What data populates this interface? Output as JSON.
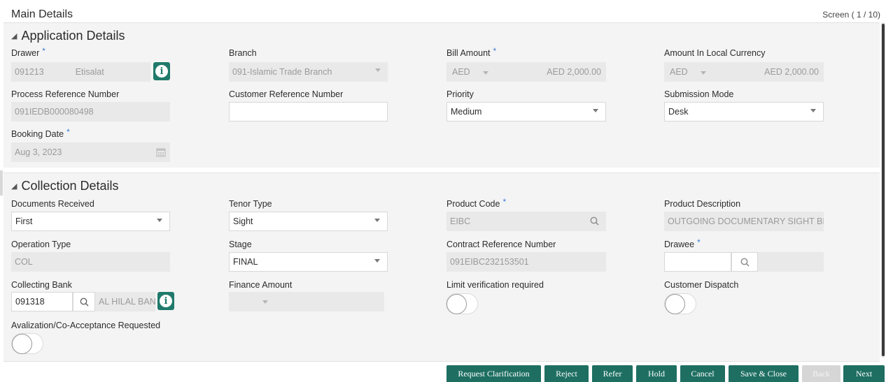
{
  "header": {
    "title": "Main Details",
    "screen": "Screen ( 1 / 10)"
  },
  "application_details": {
    "title": "Application Details",
    "drawer": {
      "label": "Drawer",
      "id": "091213",
      "name": "Etisalat"
    },
    "branch": {
      "label": "Branch",
      "value": "091-Islamic Trade Branch"
    },
    "bill_amount": {
      "label": "Bill Amount",
      "currency": "AED",
      "amount": "AED 2,000.00"
    },
    "amount_local": {
      "label": "Amount In Local Currency",
      "currency": "AED",
      "amount": "AED 2,000.00"
    },
    "process_ref": {
      "label": "Process Reference Number",
      "value": "091IEDB000080498"
    },
    "customer_ref": {
      "label": "Customer Reference Number",
      "value": ""
    },
    "priority": {
      "label": "Priority",
      "value": "Medium"
    },
    "submission_mode": {
      "label": "Submission Mode",
      "value": "Desk"
    },
    "booking_date": {
      "label": "Booking Date",
      "value": "Aug 3, 2023"
    }
  },
  "collection_details": {
    "title": "Collection Details",
    "documents_received": {
      "label": "Documents Received",
      "value": "First"
    },
    "tenor_type": {
      "label": "Tenor Type",
      "value": "Sight"
    },
    "product_code": {
      "label": "Product Code",
      "value": "EIBC"
    },
    "product_description": {
      "label": "Product Description",
      "value": "OUTGOING DOCUMENTARY SIGHT BILL"
    },
    "operation_type": {
      "label": "Operation Type",
      "value": "COL"
    },
    "stage": {
      "label": "Stage",
      "value": "FINAL"
    },
    "contract_ref": {
      "label": "Contract Reference Number",
      "value": "091EIBC232153501"
    },
    "drawee": {
      "label": "Drawee",
      "id": "",
      "name": ""
    },
    "collecting_bank": {
      "label": "Collecting Bank",
      "id": "091318",
      "name": "AL HILAL BAN"
    },
    "finance_amount": {
      "label": "Finance Amount",
      "value": ""
    },
    "limit_verification": {
      "label": "Limit verification required",
      "on": false
    },
    "customer_dispatch": {
      "label": "Customer Dispatch",
      "on": false
    },
    "avalization": {
      "label": "Avalization/Co-Acceptance Requested",
      "on": false
    }
  },
  "required_marker": "*",
  "footer": {
    "request_clarification": "Request Clarification",
    "reject": "Reject",
    "refer": "Refer",
    "hold": "Hold",
    "cancel": "Cancel",
    "save_close": "Save & Close",
    "back": "Back",
    "next": "Next"
  },
  "colors": {
    "accent": "#1e6f62",
    "required": "#3a7bd5",
    "readonly_bg": "#e9e9e9",
    "section_bg": "#f4f4f4"
  }
}
